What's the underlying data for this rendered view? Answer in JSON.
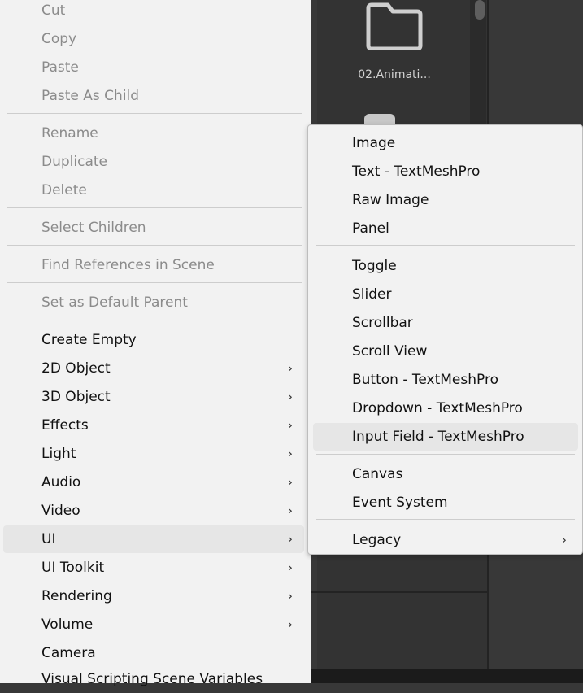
{
  "project": {
    "folder_label": "02.Animati..."
  },
  "context_menu": {
    "edit_group": [
      "Cut",
      "Copy",
      "Paste",
      "Paste As Child"
    ],
    "modify_group": [
      "Rename",
      "Duplicate",
      "Delete"
    ],
    "select_children": "Select Children",
    "find_references": "Find References in Scene",
    "set_default_parent": "Set as Default Parent",
    "create_items": [
      {
        "label": "Create Empty",
        "has_submenu": false
      },
      {
        "label": "2D Object",
        "has_submenu": true
      },
      {
        "label": "3D Object",
        "has_submenu": true
      },
      {
        "label": "Effects",
        "has_submenu": true
      },
      {
        "label": "Light",
        "has_submenu": true
      },
      {
        "label": "Audio",
        "has_submenu": true
      },
      {
        "label": "Video",
        "has_submenu": true
      },
      {
        "label": "UI",
        "has_submenu": true,
        "highlighted": true
      },
      {
        "label": "UI Toolkit",
        "has_submenu": true
      },
      {
        "label": "Rendering",
        "has_submenu": true
      },
      {
        "label": "Volume",
        "has_submenu": true
      },
      {
        "label": "Camera",
        "has_submenu": false
      },
      {
        "label": "Visual Scripting Scene Variables",
        "has_submenu": false
      }
    ],
    "arrow_glyph": "›"
  },
  "ui_submenu": {
    "graphics": [
      "Image",
      "Text - TextMeshPro",
      "Raw Image",
      "Panel"
    ],
    "controls": [
      "Toggle",
      "Slider",
      "Scrollbar",
      "Scroll View",
      "Button - TextMeshPro",
      "Dropdown - TextMeshPro",
      "Input Field - TextMeshPro"
    ],
    "highlighted": "Input Field - TextMeshPro",
    "canvas_group": [
      "Canvas",
      "Event System"
    ],
    "legacy": "Legacy"
  },
  "colors": {
    "menu_bg": "#f2f2f2",
    "highlight_bg": "#e6e6e6",
    "disabled_text": "#8b8b8b",
    "editor_bg": "#383838"
  }
}
